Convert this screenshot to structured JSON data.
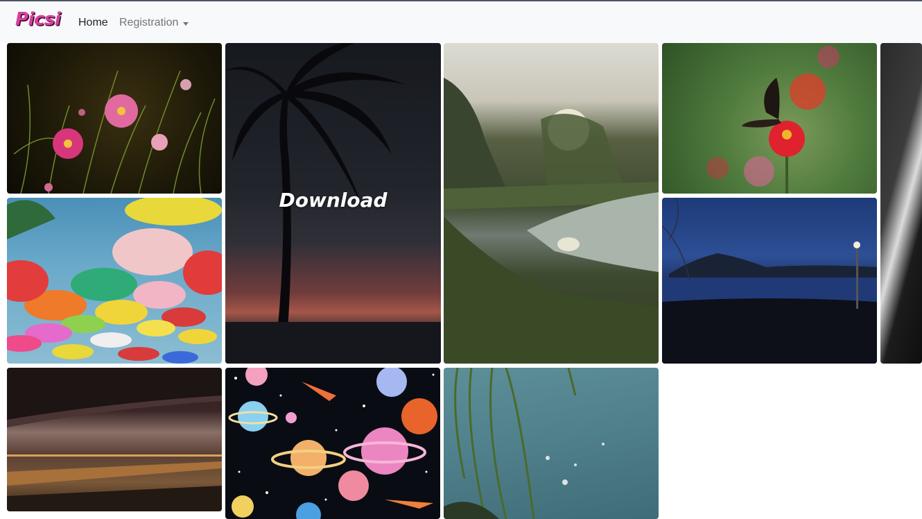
{
  "navbar": {
    "brand": "Picsi",
    "home_label": "Home",
    "registration_label": "Registration"
  },
  "gallery": {
    "hover_label": "Download",
    "photos": [
      {
        "subject": "pink cosmos flowers at night",
        "column": 1
      },
      {
        "subject": "colorful hanging umbrellas",
        "column": 1
      },
      {
        "subject": "highway overpass at dusk",
        "column": 1
      },
      {
        "subject": "palm tree silhouette at sunset",
        "column": 2,
        "hovered": true
      },
      {
        "subject": "outer space planets illustration",
        "column": 2
      },
      {
        "subject": "sunlit pond with reeds",
        "column": 3
      },
      {
        "subject": "willow branches over water",
        "column": 3
      },
      {
        "subject": "butterfly on red zinnia",
        "column": 4
      },
      {
        "subject": "night coastline with streetlamp",
        "column": 4
      },
      {
        "subject": "dark abstract close-up",
        "column": 5
      }
    ]
  },
  "colors": {
    "brand": "#d6409f",
    "navbar_bg": "#f8f9fa",
    "nav_active": "#212529",
    "nav_muted": "#6c757d"
  }
}
